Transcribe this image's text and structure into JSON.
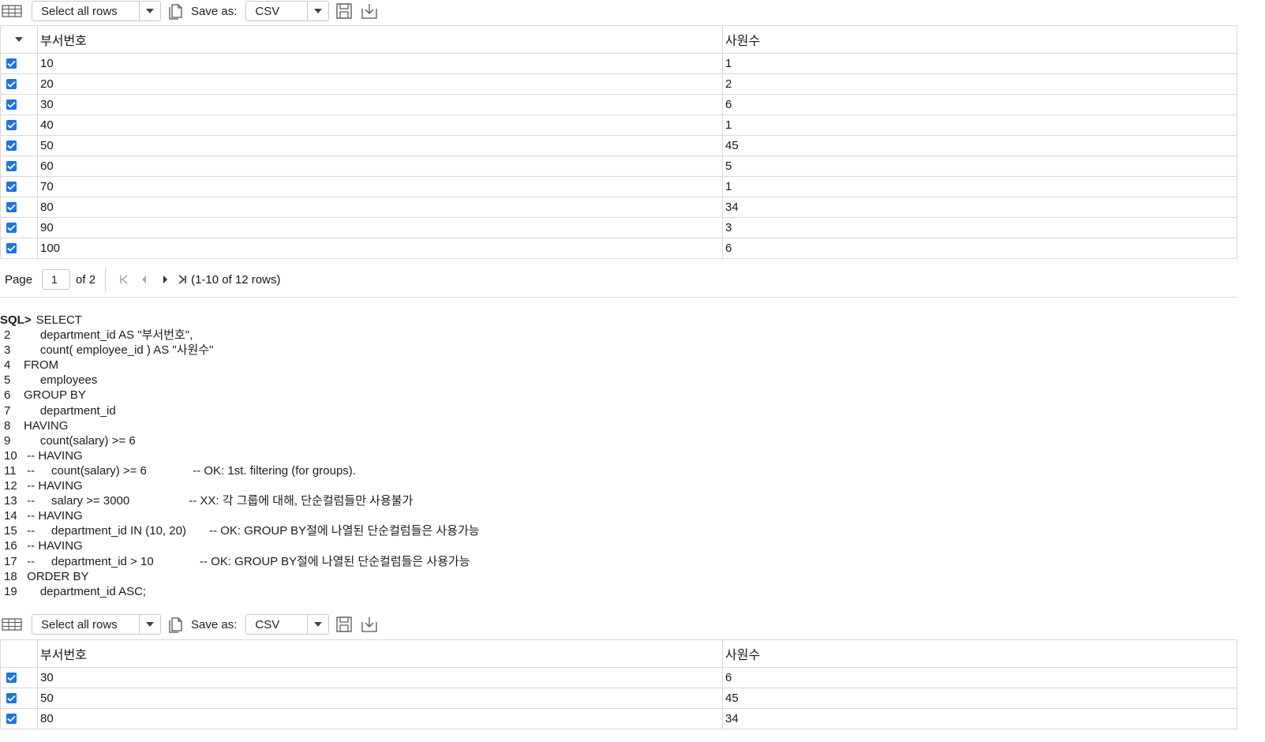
{
  "toolbar1": {
    "select_all_label": "Select all rows",
    "save_as_label": "Save as:",
    "format_value": "CSV"
  },
  "table1": {
    "columns": [
      "부서번호",
      "사원수"
    ],
    "rows": [
      [
        "10",
        "1"
      ],
      [
        "20",
        "2"
      ],
      [
        "30",
        "6"
      ],
      [
        "40",
        "1"
      ],
      [
        "50",
        "45"
      ],
      [
        "60",
        "5"
      ],
      [
        "70",
        "1"
      ],
      [
        "80",
        "34"
      ],
      [
        "90",
        "3"
      ],
      [
        "100",
        "6"
      ]
    ]
  },
  "pager": {
    "page_label": "Page",
    "page_value": "1",
    "of_label": "of 2",
    "rows_info": "(1-10 of 12 rows)"
  },
  "sql": {
    "prompt": "SQL>",
    "lines": [
      {
        "n": "",
        "text": "SELECT"
      },
      {
        "n": "2",
        "text": "     department_id AS \"부서번호\","
      },
      {
        "n": "3",
        "text": "     count( employee_id ) AS \"사원수\""
      },
      {
        "n": "4",
        "text": "FROM"
      },
      {
        "n": "5",
        "text": "     employees"
      },
      {
        "n": "6",
        "text": "GROUP BY"
      },
      {
        "n": "7",
        "text": "     department_id"
      },
      {
        "n": "8",
        "text": "HAVING"
      },
      {
        "n": "9",
        "text": "     count(salary) >= 6"
      },
      {
        "n": "10",
        "text": " -- HAVING"
      },
      {
        "n": "11",
        "text": " --     count(salary) >= 6              -- OK: 1st. filtering (for groups)."
      },
      {
        "n": "12",
        "text": " -- HAVING"
      },
      {
        "n": "13",
        "text": " --     salary >= 3000                  -- XX: 각 그룹에 대해, 단순컬럼들만 사용불가"
      },
      {
        "n": "14",
        "text": " -- HAVING"
      },
      {
        "n": "15",
        "text": " --     department_id IN (10, 20)       -- OK: GROUP BY절에 나열된 단순컬럼들은 사용가능"
      },
      {
        "n": "16",
        "text": " -- HAVING"
      },
      {
        "n": "17",
        "text": " --     department_id > 10              -- OK: GROUP BY절에 나열된 단순컬럼들은 사용가능"
      },
      {
        "n": "18",
        "text": " ORDER BY"
      },
      {
        "n": "19",
        "text": "     department_id ASC;"
      }
    ]
  },
  "toolbar2": {
    "select_all_label": "Select all rows",
    "save_as_label": "Save as:",
    "format_value": "CSV"
  },
  "table2": {
    "columns": [
      "부서번호",
      "사원수"
    ],
    "rows": [
      [
        "30",
        "6"
      ],
      [
        "50",
        "45"
      ],
      [
        "80",
        "34"
      ]
    ]
  },
  "colors": {
    "accent": "#1a73e8",
    "border": "#d9d9d9"
  }
}
